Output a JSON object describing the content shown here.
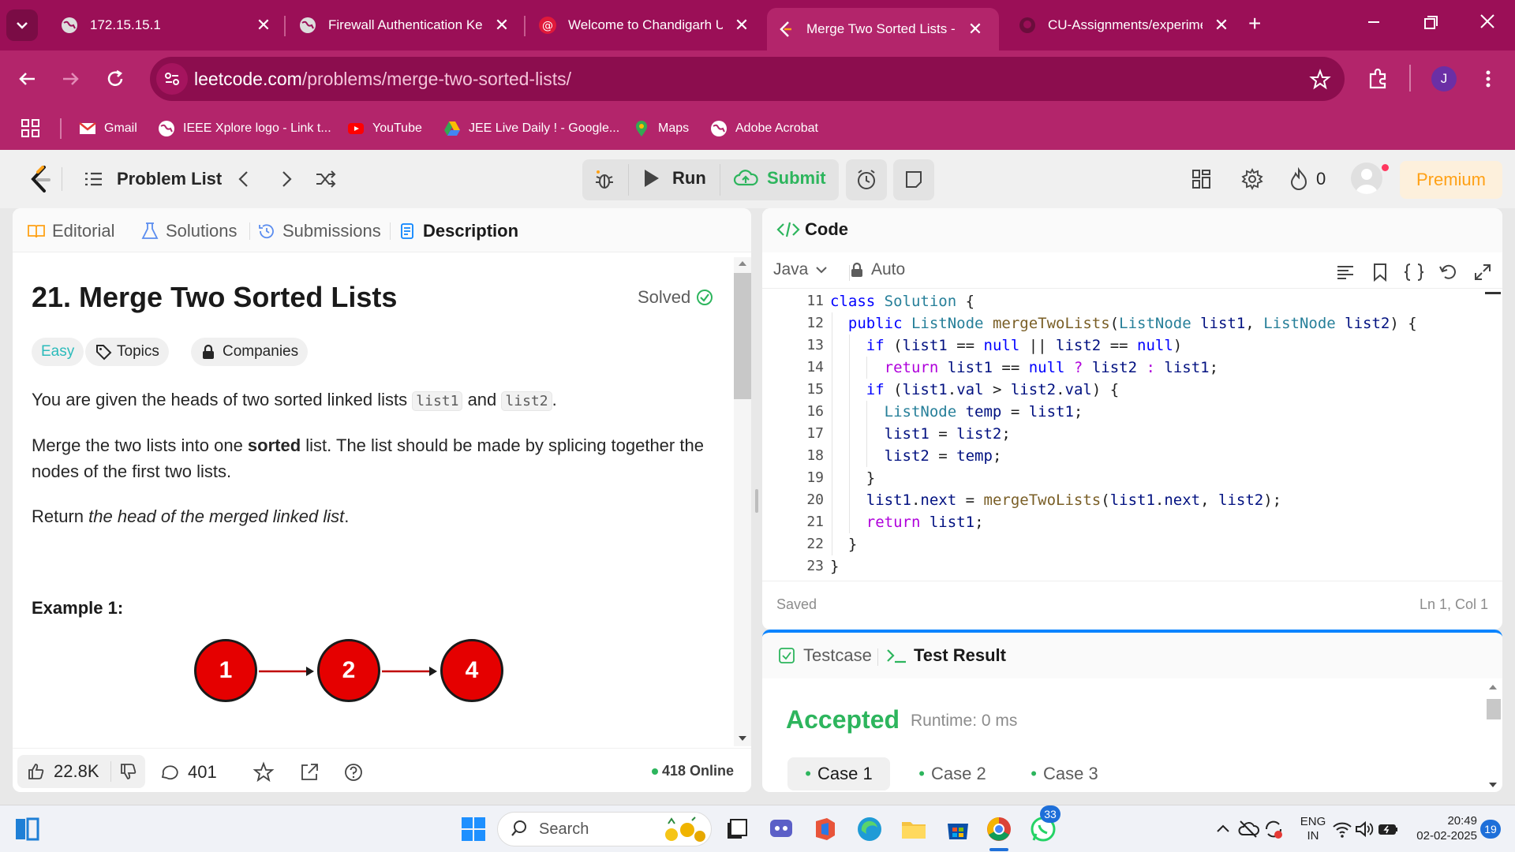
{
  "browser": {
    "tabs": [
      {
        "title": "172.15.15.1"
      },
      {
        "title": "Firewall Authentication Keep"
      },
      {
        "title": "Welcome to Chandigarh Uni"
      },
      {
        "title": "Merge Two Sorted Lists - Le"
      },
      {
        "title": "CU-Assignments/experimen"
      }
    ],
    "url_host": "leetcode.com",
    "url_path": "/problems/merge-two-sorted-lists/",
    "profile_initial": "J",
    "bookmarks": [
      "Gmail",
      "IEEE Xplore logo - Link t...",
      "YouTube",
      "JEE Live Daily ! - Google...",
      "Maps",
      "Adobe Acrobat"
    ]
  },
  "toolbar": {
    "problem_list": "Problem List",
    "run": "Run",
    "submit": "Submit",
    "streak": "0",
    "premium": "Premium"
  },
  "left_tabs": {
    "editorial": "Editorial",
    "solutions": "Solutions",
    "submissions": "Submissions",
    "description": "Description"
  },
  "problem": {
    "title": "21. Merge Two Sorted Lists",
    "status": "Solved",
    "difficulty": "Easy",
    "topics": "Topics",
    "companies": "Companies",
    "p1_a": "You are given the heads of two sorted linked lists ",
    "p1_code1": "list1",
    "p1_and": " and ",
    "p1_code2": "list2",
    "p1_end": ".",
    "p2_a": "Merge the two lists into one ",
    "p2_bold": "sorted",
    "p2_b": " list. The list should be made by splicing together the nodes of the first two lists.",
    "p3_a": "Return ",
    "p3_ital": "the head of the merged linked list",
    "p3_end": ".",
    "example_label": "Example 1:",
    "example_nodes": [
      "1",
      "2",
      "4"
    ]
  },
  "footer_stats": {
    "likes": "22.8K",
    "comments": "401",
    "online": "418 Online"
  },
  "code_panel": {
    "title": "Code",
    "language": "Java",
    "mode": "Auto",
    "saved": "Saved",
    "cursor": "Ln 1, Col 1",
    "line_numbers": [
      "11",
      "12",
      "13",
      "14",
      "15",
      "16",
      "17",
      "18",
      "19",
      "20",
      "21",
      "22",
      "23"
    ]
  },
  "result_panel": {
    "testcase_tab": "Testcase",
    "result_tab": "Test Result",
    "verdict": "Accepted",
    "runtime": "Runtime: 0 ms",
    "cases": [
      "Case 1",
      "Case 2",
      "Case 3"
    ]
  },
  "taskbar": {
    "search": "Search",
    "lang1": "ENG",
    "lang2": "IN",
    "time": "20:49",
    "date": "02-02-2025",
    "notif_count": "19",
    "whatsapp_badge": "33"
  }
}
